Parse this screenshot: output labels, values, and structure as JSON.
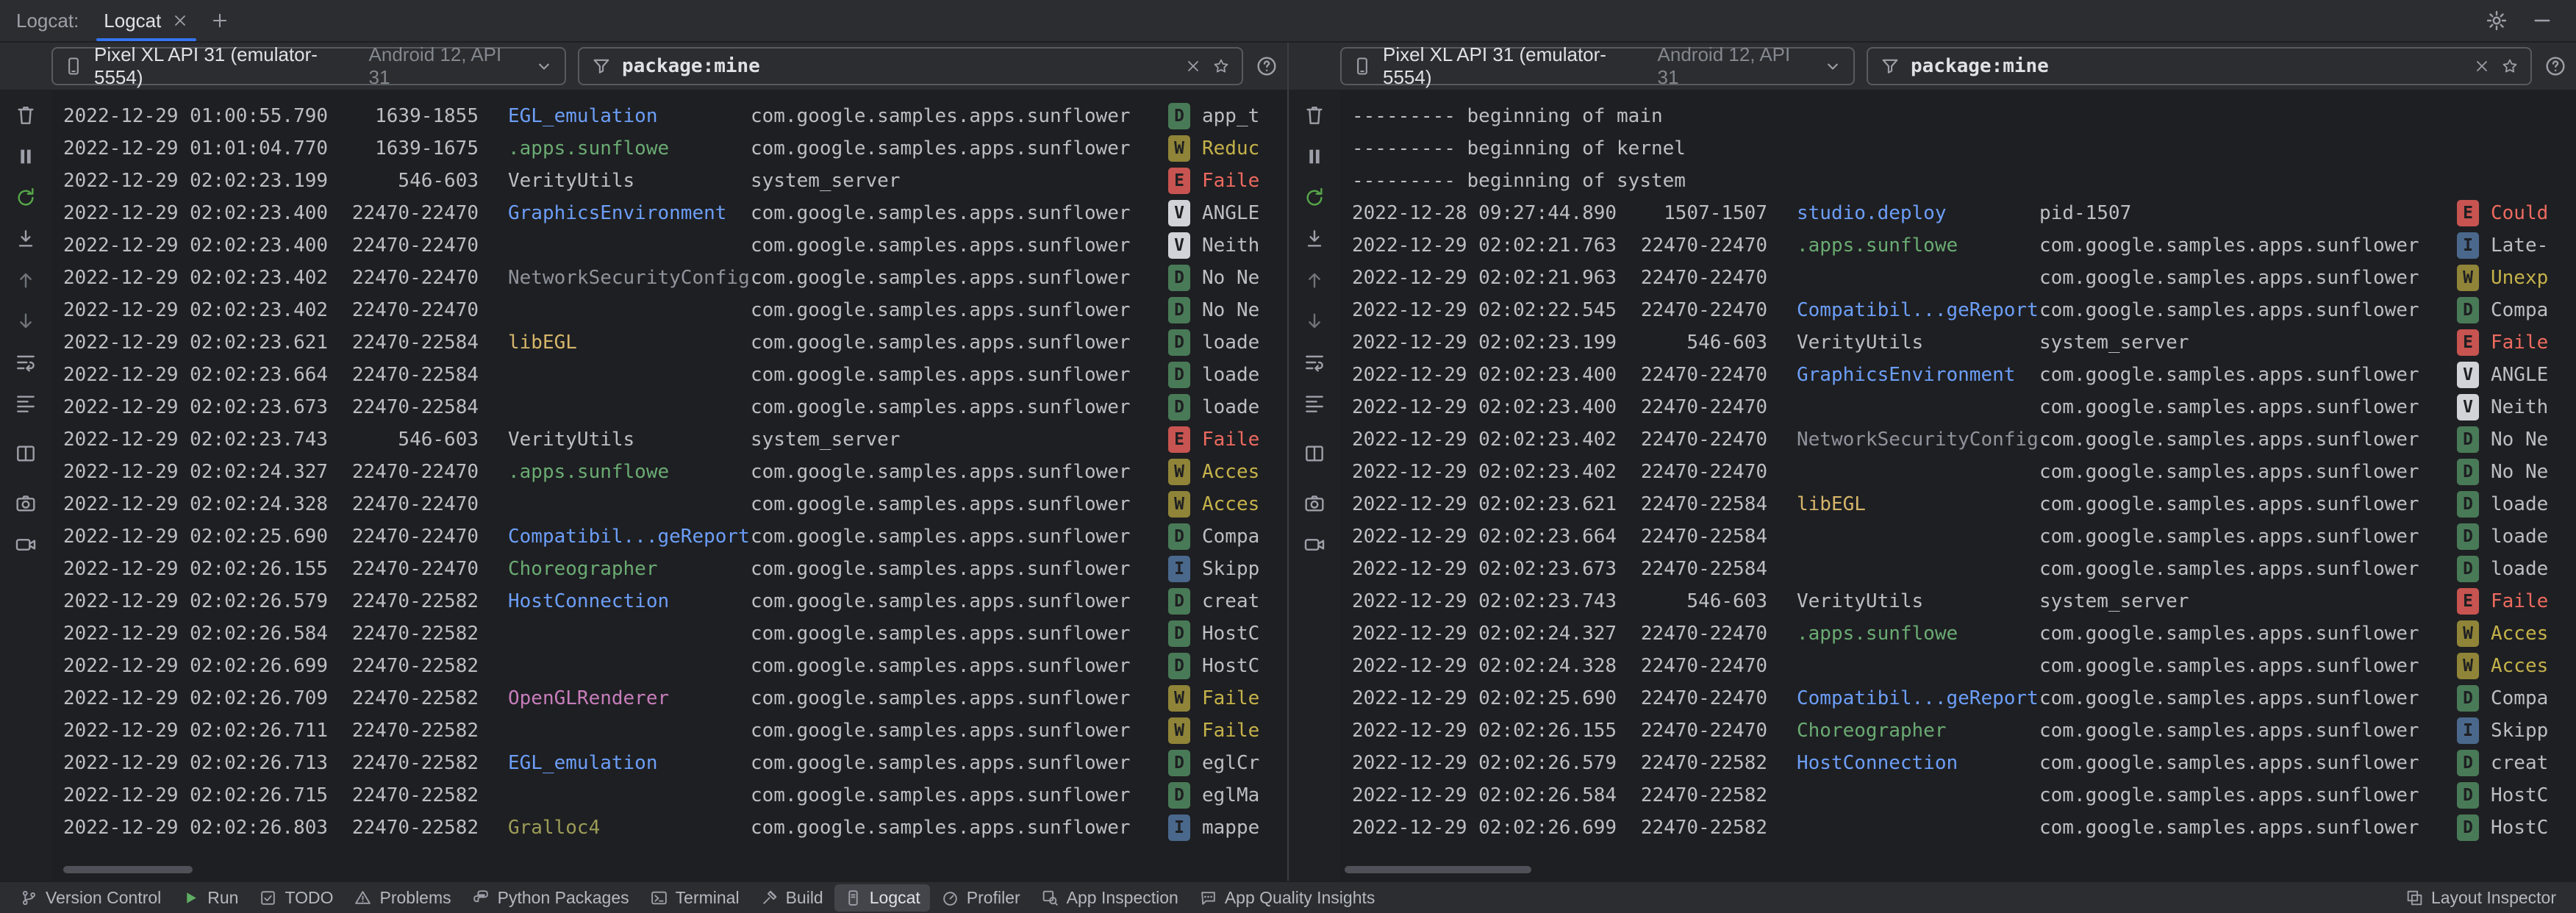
{
  "colors": {
    "accent": "#3574F0",
    "level_text": "#1E1F22",
    "levels": {
      "V": "#D1D3D8",
      "D": "#497A57",
      "I": "#4A688C",
      "W": "#8F8438",
      "E": "#C75450"
    },
    "messages": {
      "E": "#ED6A5F",
      "W": "#C5B24A",
      "default": "#BCBEC4"
    },
    "tags": {
      "blue": "#6C9EF8",
      "green": "#6AAB73",
      "yellow": "#D5B56A",
      "gray": "#8F939B",
      "pink": "#C77DBB",
      "olive": "#9C9C57",
      "default": "#BCBEC4"
    }
  },
  "tab_bar": {
    "label": "Logcat:",
    "tab_title": "Logcat",
    "add_label": "+"
  },
  "panel_toolbar_icons": [
    {
      "name": "clear-logcat-icon"
    },
    {
      "name": "pause-logcat-icon"
    },
    {
      "name": "restart-logcat-icon",
      "color": "#57A64A"
    },
    {
      "name": "scroll-to-end-icon"
    },
    {
      "name": "previous-occurrence-icon",
      "color": "#6F737A"
    },
    {
      "name": "next-occurrence-icon",
      "color": "#6F737A"
    },
    {
      "name": "soft-wrap-icon"
    },
    {
      "name": "formatting-options-icon"
    },
    {
      "name": "split-panels-icon",
      "group": true
    },
    {
      "name": "screenshot-icon",
      "group": true
    },
    {
      "name": "screen-record-icon"
    }
  ],
  "panels": [
    {
      "device": {
        "name": "Pixel XL API 31 (emulator-5554)",
        "detail": "Android 12, API 31"
      },
      "filter": {
        "value": "package:mine"
      },
      "rows": [
        {
          "time": "2022-12-29 01:00:55.790",
          "pid": "1639-1855",
          "tag": "EGL_emulation",
          "tag_color": "blue",
          "package": "com.google.samples.apps.sunflower",
          "level": "D",
          "message": "app_t"
        },
        {
          "time": "2022-12-29 01:01:04.770",
          "pid": "1639-1675",
          "tag": ".apps.sunflowe",
          "tag_color": "green",
          "package": "com.google.samples.apps.sunflower",
          "level": "W",
          "message": "Reduc"
        },
        {
          "time": "2022-12-29 02:02:23.199",
          "pid": "546-603",
          "tag": "VerityUtils",
          "tag_color": "default",
          "package": "system_server",
          "level": "E",
          "message": "Faile"
        },
        {
          "time": "2022-12-29 02:02:23.400",
          "pid": "22470-22470",
          "tag": "GraphicsEnvironment",
          "tag_color": "blue",
          "package": "com.google.samples.apps.sunflower",
          "level": "V",
          "message": "ANGLE"
        },
        {
          "time": "2022-12-29 02:02:23.400",
          "pid": "22470-22470",
          "tag": "",
          "package": "com.google.samples.apps.sunflower",
          "level": "V",
          "message": "Neith"
        },
        {
          "time": "2022-12-29 02:02:23.402",
          "pid": "22470-22470",
          "tag": "NetworkSecurityConfig",
          "tag_color": "gray",
          "package": "com.google.samples.apps.sunflower",
          "level": "D",
          "message": "No Ne"
        },
        {
          "time": "2022-12-29 02:02:23.402",
          "pid": "22470-22470",
          "tag": "",
          "package": "com.google.samples.apps.sunflower",
          "level": "D",
          "message": "No Ne"
        },
        {
          "time": "2022-12-29 02:02:23.621",
          "pid": "22470-22584",
          "tag": "libEGL",
          "tag_color": "yellow",
          "package": "com.google.samples.apps.sunflower",
          "level": "D",
          "message": "loade"
        },
        {
          "time": "2022-12-29 02:02:23.664",
          "pid": "22470-22584",
          "tag": "",
          "package": "com.google.samples.apps.sunflower",
          "level": "D",
          "message": "loade"
        },
        {
          "time": "2022-12-29 02:02:23.673",
          "pid": "22470-22584",
          "tag": "",
          "package": "com.google.samples.apps.sunflower",
          "level": "D",
          "message": "loade"
        },
        {
          "time": "2022-12-29 02:02:23.743",
          "pid": "546-603",
          "tag": "VerityUtils",
          "tag_color": "default",
          "package": "system_server",
          "level": "E",
          "message": "Faile"
        },
        {
          "time": "2022-12-29 02:02:24.327",
          "pid": "22470-22470",
          "tag": ".apps.sunflowe",
          "tag_color": "green",
          "package": "com.google.samples.apps.sunflower",
          "level": "W",
          "message": "Acces"
        },
        {
          "time": "2022-12-29 02:02:24.328",
          "pid": "22470-22470",
          "tag": "",
          "package": "com.google.samples.apps.sunflower",
          "level": "W",
          "message": "Acces"
        },
        {
          "time": "2022-12-29 02:02:25.690",
          "pid": "22470-22470",
          "tag": "Compatibil...geReporter",
          "tag_color": "blue",
          "package": "com.google.samples.apps.sunflower",
          "level": "D",
          "message": "Compa"
        },
        {
          "time": "2022-12-29 02:02:26.155",
          "pid": "22470-22470",
          "tag": "Choreographer",
          "tag_color": "green",
          "package": "com.google.samples.apps.sunflower",
          "level": "I",
          "message": "Skipp"
        },
        {
          "time": "2022-12-29 02:02:26.579",
          "pid": "22470-22582",
          "tag": "HostConnection",
          "tag_color": "blue",
          "package": "com.google.samples.apps.sunflower",
          "level": "D",
          "message": "creat"
        },
        {
          "time": "2022-12-29 02:02:26.584",
          "pid": "22470-22582",
          "tag": "",
          "package": "com.google.samples.apps.sunflower",
          "level": "D",
          "message": "HostC"
        },
        {
          "time": "2022-12-29 02:02:26.699",
          "pid": "22470-22582",
          "tag": "",
          "package": "com.google.samples.apps.sunflower",
          "level": "D",
          "message": "HostC"
        },
        {
          "time": "2022-12-29 02:02:26.709",
          "pid": "22470-22582",
          "tag": "OpenGLRenderer",
          "tag_color": "pink",
          "package": "com.google.samples.apps.sunflower",
          "level": "W",
          "message": "Faile"
        },
        {
          "time": "2022-12-29 02:02:26.711",
          "pid": "22470-22582",
          "tag": "",
          "package": "com.google.samples.apps.sunflower",
          "level": "W",
          "message": "Faile"
        },
        {
          "time": "2022-12-29 02:02:26.713",
          "pid": "22470-22582",
          "tag": "EGL_emulation",
          "tag_color": "blue",
          "package": "com.google.samples.apps.sunflower",
          "level": "D",
          "message": "eglCr"
        },
        {
          "time": "2022-12-29 02:02:26.715",
          "pid": "22470-22582",
          "tag": "",
          "package": "com.google.samples.apps.sunflower",
          "level": "D",
          "message": "eglMa"
        },
        {
          "time": "2022-12-29 02:02:26.803",
          "pid": "22470-22582",
          "tag": "Gralloc4",
          "tag_color": "olive",
          "package": "com.google.samples.apps.sunflower",
          "level": "I",
          "message": "mappe"
        }
      ]
    },
    {
      "device": {
        "name": "Pixel XL API 31 (emulator-5554)",
        "detail": "Android 12, API 31"
      },
      "filter": {
        "value": "package:mine"
      },
      "rows": [
        {
          "separator": "--------- beginning of main"
        },
        {
          "separator": "--------- beginning of kernel"
        },
        {
          "separator": "--------- beginning of system"
        },
        {
          "time": "2022-12-28 09:27:44.890",
          "pid": "1507-1507",
          "tag": "studio.deploy",
          "tag_color": "blue",
          "package": "pid-1507",
          "level": "E",
          "message": "Could"
        },
        {
          "time": "2022-12-29 02:02:21.763",
          "pid": "22470-22470",
          "tag": ".apps.sunflowe",
          "tag_color": "green",
          "package": "com.google.samples.apps.sunflower",
          "level": "I",
          "message": "Late-"
        },
        {
          "time": "2022-12-29 02:02:21.963",
          "pid": "22470-22470",
          "tag": "",
          "package": "com.google.samples.apps.sunflower",
          "level": "W",
          "message": "Unexp"
        },
        {
          "time": "2022-12-29 02:02:22.545",
          "pid": "22470-22470",
          "tag": "Compatibil...geReporter",
          "tag_color": "blue",
          "package": "com.google.samples.apps.sunflower",
          "level": "D",
          "message": "Compa"
        },
        {
          "time": "2022-12-29 02:02:23.199",
          "pid": "546-603",
          "tag": "VerityUtils",
          "tag_color": "default",
          "package": "system_server",
          "level": "E",
          "message": "Faile"
        },
        {
          "time": "2022-12-29 02:02:23.400",
          "pid": "22470-22470",
          "tag": "GraphicsEnvironment",
          "tag_color": "blue",
          "package": "com.google.samples.apps.sunflower",
          "level": "V",
          "message": "ANGLE"
        },
        {
          "time": "2022-12-29 02:02:23.400",
          "pid": "22470-22470",
          "tag": "",
          "package": "com.google.samples.apps.sunflower",
          "level": "V",
          "message": "Neith"
        },
        {
          "time": "2022-12-29 02:02:23.402",
          "pid": "22470-22470",
          "tag": "NetworkSecurityConfig",
          "tag_color": "gray",
          "package": "com.google.samples.apps.sunflower",
          "level": "D",
          "message": "No Ne"
        },
        {
          "time": "2022-12-29 02:02:23.402",
          "pid": "22470-22470",
          "tag": "",
          "package": "com.google.samples.apps.sunflower",
          "level": "D",
          "message": "No Ne"
        },
        {
          "time": "2022-12-29 02:02:23.621",
          "pid": "22470-22584",
          "tag": "libEGL",
          "tag_color": "yellow",
          "package": "com.google.samples.apps.sunflower",
          "level": "D",
          "message": "loade"
        },
        {
          "time": "2022-12-29 02:02:23.664",
          "pid": "22470-22584",
          "tag": "",
          "package": "com.google.samples.apps.sunflower",
          "level": "D",
          "message": "loade"
        },
        {
          "time": "2022-12-29 02:02:23.673",
          "pid": "22470-22584",
          "tag": "",
          "package": "com.google.samples.apps.sunflower",
          "level": "D",
          "message": "loade"
        },
        {
          "time": "2022-12-29 02:02:23.743",
          "pid": "546-603",
          "tag": "VerityUtils",
          "tag_color": "default",
          "package": "system_server",
          "level": "E",
          "message": "Faile"
        },
        {
          "time": "2022-12-29 02:02:24.327",
          "pid": "22470-22470",
          "tag": ".apps.sunflowe",
          "tag_color": "green",
          "package": "com.google.samples.apps.sunflower",
          "level": "W",
          "message": "Acces"
        },
        {
          "time": "2022-12-29 02:02:24.328",
          "pid": "22470-22470",
          "tag": "",
          "package": "com.google.samples.apps.sunflower",
          "level": "W",
          "message": "Acces"
        },
        {
          "time": "2022-12-29 02:02:25.690",
          "pid": "22470-22470",
          "tag": "Compatibil...geReporter",
          "tag_color": "blue",
          "package": "com.google.samples.apps.sunflower",
          "level": "D",
          "message": "Compa"
        },
        {
          "time": "2022-12-29 02:02:26.155",
          "pid": "22470-22470",
          "tag": "Choreographer",
          "tag_color": "green",
          "package": "com.google.samples.apps.sunflower",
          "level": "I",
          "message": "Skipp"
        },
        {
          "time": "2022-12-29 02:02:26.579",
          "pid": "22470-22582",
          "tag": "HostConnection",
          "tag_color": "blue",
          "package": "com.google.samples.apps.sunflower",
          "level": "D",
          "message": "creat"
        },
        {
          "time": "2022-12-29 02:02:26.584",
          "pid": "22470-22582",
          "tag": "",
          "package": "com.google.samples.apps.sunflower",
          "level": "D",
          "message": "HostC"
        },
        {
          "time": "2022-12-29 02:02:26.699",
          "pid": "22470-22582",
          "tag": "",
          "package": "com.google.samples.apps.sunflower",
          "level": "D",
          "message": "HostC"
        }
      ]
    }
  ],
  "status_bar": {
    "left": [
      {
        "label": "Version Control",
        "icon": "version-control-icon"
      },
      {
        "label": "Run",
        "icon": "run-icon"
      },
      {
        "label": "TODO",
        "icon": "todo-icon"
      },
      {
        "label": "Problems",
        "icon": "problems-icon"
      },
      {
        "label": "Python Packages",
        "icon": "python-packages-icon"
      },
      {
        "label": "Terminal",
        "icon": "terminal-icon"
      },
      {
        "label": "Build",
        "icon": "build-icon"
      },
      {
        "label": "Logcat",
        "icon": "logcat-icon",
        "active": true
      },
      {
        "label": "Profiler",
        "icon": "profiler-icon"
      },
      {
        "label": "App Inspection",
        "icon": "app-inspection-icon"
      },
      {
        "label": "App Quality Insights",
        "icon": "app-quality-insights-icon"
      }
    ],
    "right": [
      {
        "label": "Layout Inspector",
        "icon": "layout-inspector-icon"
      }
    ]
  }
}
